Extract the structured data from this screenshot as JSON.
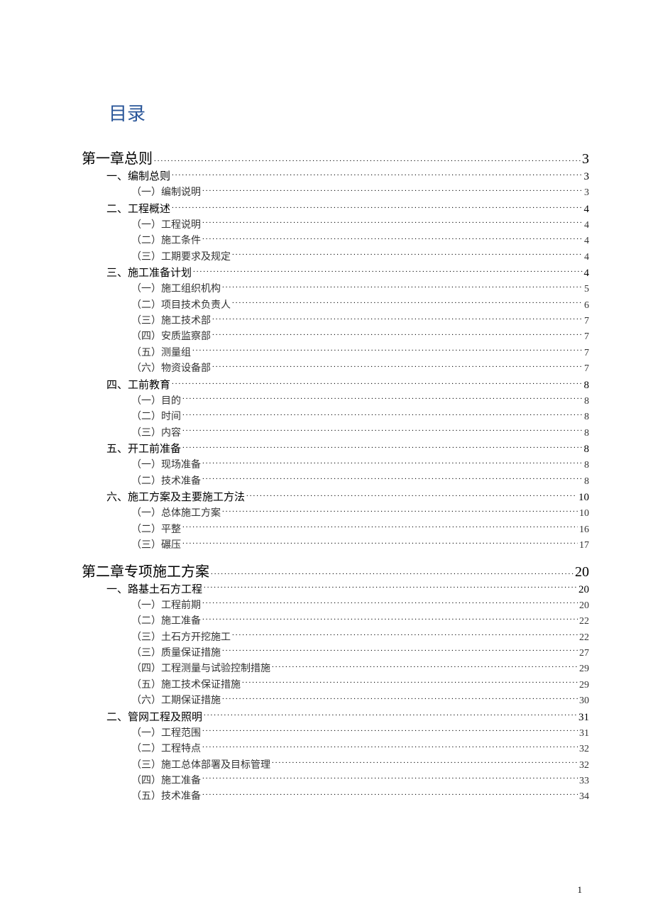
{
  "title": "目录",
  "page_number": "1",
  "entries": [
    {
      "level": 0,
      "label": "第一章总则",
      "page": "3"
    },
    {
      "level": 1,
      "label": "一、编制总则",
      "page": "3"
    },
    {
      "level": 2,
      "label": "（一）编制说明",
      "page": "3"
    },
    {
      "level": 1,
      "label": "二、工程概述",
      "page": "4"
    },
    {
      "level": 2,
      "label": "（一）工程说明",
      "page": "4"
    },
    {
      "level": 2,
      "label": "（二）施工条件",
      "page": "4"
    },
    {
      "level": 2,
      "label": "（三）工期要求及规定",
      "page": "4"
    },
    {
      "level": 1,
      "label": "三、施工准备计划",
      "page": "4"
    },
    {
      "level": 2,
      "label": "（一）施工组织机构",
      "page": "5"
    },
    {
      "level": 2,
      "label": "（二）项目技术负责人",
      "page": "6"
    },
    {
      "level": 2,
      "label": "（三）施工技术部",
      "page": "7"
    },
    {
      "level": 2,
      "label": "（四）安质监察部",
      "page": "7"
    },
    {
      "level": 2,
      "label": "（五）测量组",
      "page": "7"
    },
    {
      "level": 2,
      "label": "（六）物资设备部",
      "page": "7"
    },
    {
      "level": 1,
      "label": "四、工前教育",
      "page": "8"
    },
    {
      "level": 2,
      "label": "（一）目的",
      "page": "8"
    },
    {
      "level": 2,
      "label": "（二）时间",
      "page": "8"
    },
    {
      "level": 2,
      "label": "（三）内容",
      "page": "8"
    },
    {
      "level": 1,
      "label": "五、开工前准备",
      "page": "8"
    },
    {
      "level": 2,
      "label": "（一）现场准备",
      "page": "8"
    },
    {
      "level": 2,
      "label": "（二）技术准备",
      "page": "8"
    },
    {
      "level": 1,
      "label": "六、施工方案及主要施工方法",
      "page": "10"
    },
    {
      "level": 2,
      "label": "（一）总体施工方案",
      "page": "10"
    },
    {
      "level": 2,
      "label": "（二）平整",
      "page": "16"
    },
    {
      "level": 2,
      "label": "（三）碾压",
      "page": "17"
    },
    {
      "level": 0,
      "label": "第二章专项施工方案",
      "page": "20"
    },
    {
      "level": 1,
      "label": "一、路基土石方工程",
      "page": "20"
    },
    {
      "level": 2,
      "label": "（一）工程前期",
      "page": "20"
    },
    {
      "level": 2,
      "label": "（二）施工准备",
      "page": "22"
    },
    {
      "level": 2,
      "label": "（三）土石方开挖施工",
      "page": "22"
    },
    {
      "level": 2,
      "label": "（三）质量保证措施",
      "page": "27"
    },
    {
      "level": 2,
      "label": "（四）工程测量与试验控制措施",
      "page": "29"
    },
    {
      "level": 2,
      "label": "（五）施工技术保证措施",
      "page": "29"
    },
    {
      "level": 2,
      "label": "（六）工期保证措施",
      "page": "30"
    },
    {
      "level": 1,
      "label": "二、管网工程及照明",
      "page": "31"
    },
    {
      "level": 2,
      "label": "（一）工程范围",
      "page": "31"
    },
    {
      "level": 2,
      "label": "（二）工程特点",
      "page": "32"
    },
    {
      "level": 2,
      "label": "（三）施工总体部署及目标管理",
      "page": "32"
    },
    {
      "level": 2,
      "label": "（四）施工准备",
      "page": "33"
    },
    {
      "level": 2,
      "label": "（五）技术准备",
      "page": "34"
    }
  ]
}
